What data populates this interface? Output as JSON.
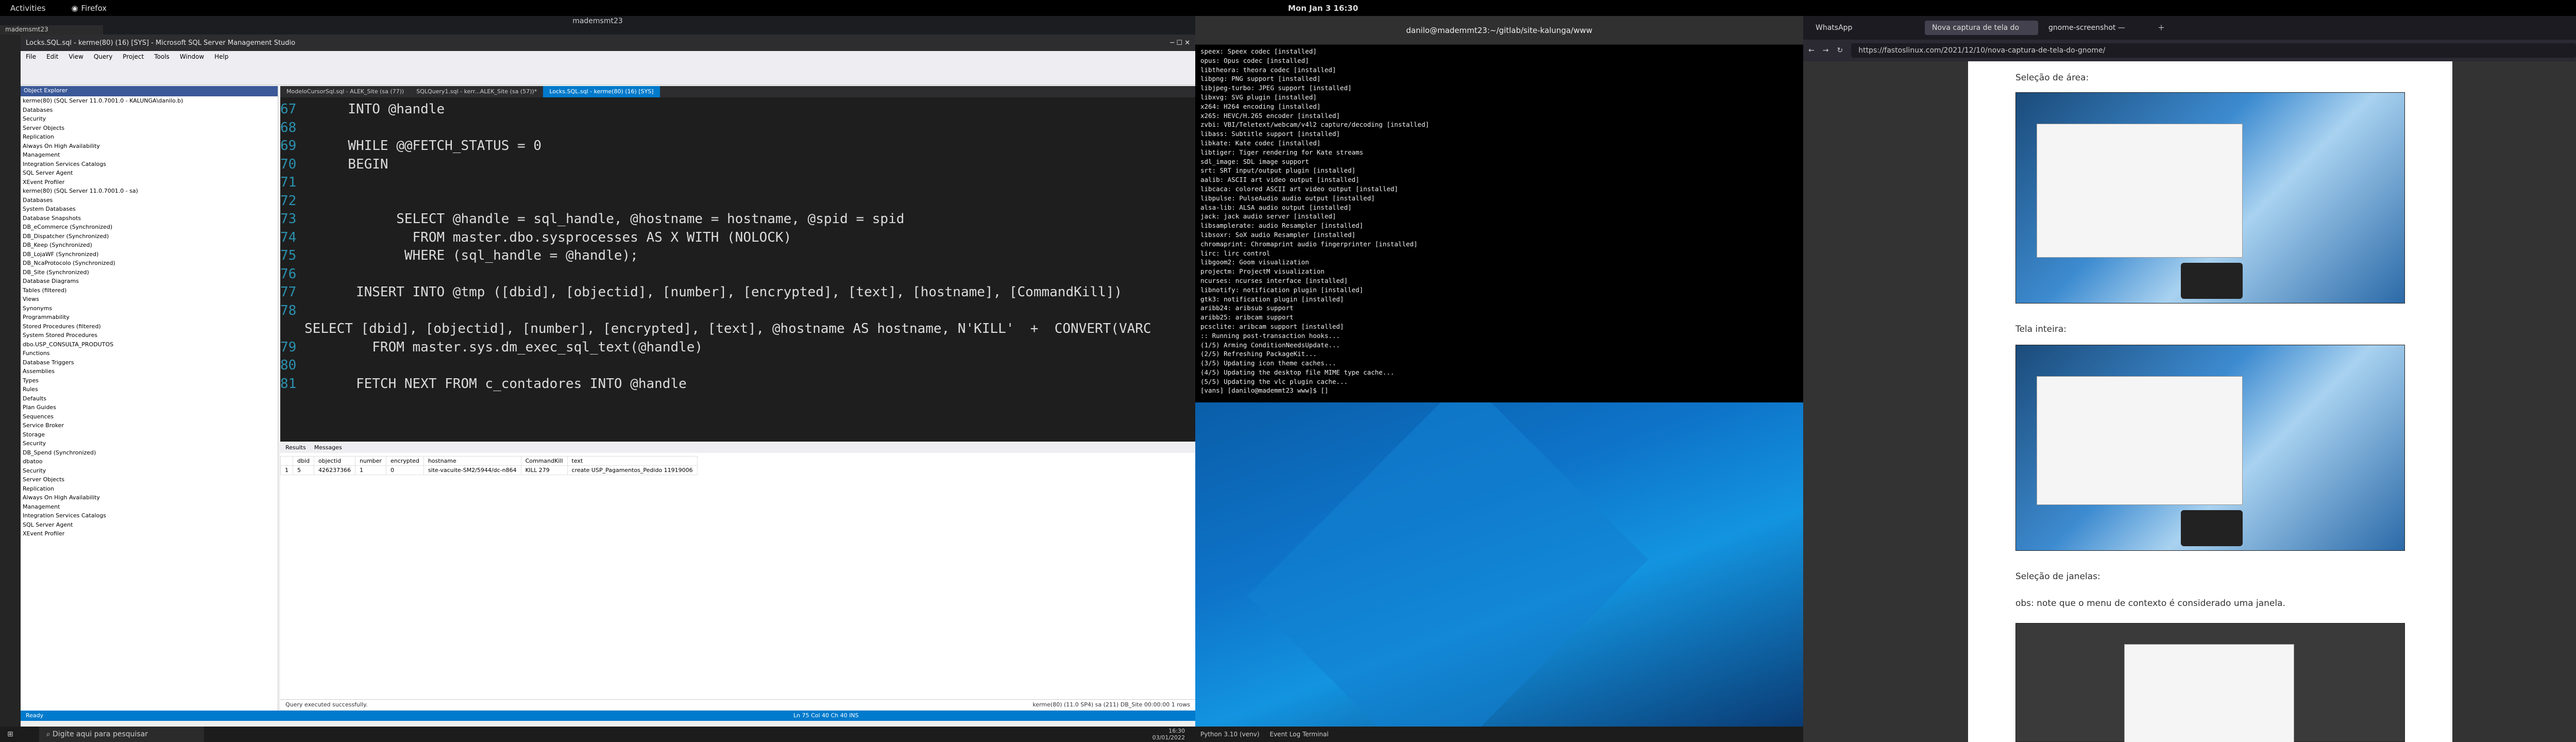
{
  "topbar": {
    "activities": "Activities",
    "app": "Firefox",
    "clock": "Mon Jan 3  16:30"
  },
  "vm": {
    "title": "mademsmt23",
    "tab": "mademsmt23"
  },
  "ssms": {
    "title": "Locks.SQL.sql - kerme(80) (16) [SYS] - Microsoft SQL Server Management Studio",
    "menu": [
      "File",
      "Edit",
      "View",
      "Query",
      "Project",
      "Tools",
      "Window",
      "Help"
    ],
    "objexp_title": "Object Explorer",
    "tree": [
      "kerme(80) (SQL Server 11.0.7001.0 - KALUNGA\\danilo.b)",
      "Databases",
      "Security",
      "Server Objects",
      "Replication",
      "Always On High Availability",
      "Management",
      "Integration Services Catalogs",
      "SQL Server Agent",
      "XEvent Profiler",
      "kerme(80) (SQL Server 11.0.7001.0 - sa)",
      "Databases",
      "System Databases",
      "Database Snapshots",
      "DB_eCommerce (Synchronized)",
      "DB_Dispatcher (Synchronized)",
      "DB_Keep (Synchronized)",
      "DB_LojaWF (Synchronized)",
      "DB_NcaProtocolo (Synchronized)",
      "DB_Site (Synchronized)",
      "Database Diagrams",
      "Tables (filtered)",
      "Views",
      "Synonyms",
      "Programmability",
      "Stored Procedures (filtered)",
      "System Stored Procedures",
      "dbo.USP_CONSULTA_PRODUTOS",
      "Functions",
      "Database Triggers",
      "Assemblies",
      "Types",
      "Rules",
      "Defaults",
      "Plan Guides",
      "Sequences",
      "Service Broker",
      "Storage",
      "Security",
      "DB_Spend (Synchronized)",
      "dbatoo",
      "Security",
      "Server Objects",
      "Replication",
      "Always On High Availability",
      "Management",
      "Integration Services Catalogs",
      "SQL Server Agent",
      "XEvent Profiler"
    ],
    "editor_tabs": [
      "ModeloCursorSql.sql - ALEK_Site (sa (77))",
      "SQLQuery1.sql - kerr...ALEK_Site (sa (57))*",
      "Locks.SQL.sql - kerme(80) (16) [SYS]"
    ],
    "code_lines": [
      {
        "n": "67",
        "t": "  INTO @handle"
      },
      {
        "n": "68",
        "t": ""
      },
      {
        "n": "69",
        "t": "  WHILE @@FETCH_STATUS = 0"
      },
      {
        "n": "70",
        "t": "  BEGIN"
      },
      {
        "n": "71",
        "t": ""
      },
      {
        "n": "72",
        "t": ""
      },
      {
        "n": "73",
        "t": "        SELECT @handle = sql_handle, @hostname = hostname, @spid = spid"
      },
      {
        "n": "74",
        "t": "          FROM master.dbo.sysprocesses AS X WITH (NOLOCK)"
      },
      {
        "n": "75",
        "t": "         WHERE (sql_handle = @handle);"
      },
      {
        "n": "76",
        "t": ""
      },
      {
        "n": "77",
        "t": "   INSERT INTO @tmp ([dbid], [objectid], [number], [encrypted], [text], [hostname], [CommandKill])"
      },
      {
        "n": "78",
        "t": "   SELECT [dbid], [objectid], [number], [encrypted], [text], @hostname AS hostname, N'KILL'  +  CONVERT(VARC"
      },
      {
        "n": "79",
        "t": "     FROM master.sys.dm_exec_sql_text(@handle)"
      },
      {
        "n": "80",
        "t": ""
      },
      {
        "n": "81",
        "t": "   FETCH NEXT FROM c_contadores INTO @handle"
      }
    ],
    "results_tabs": [
      "Results",
      "Messages"
    ],
    "grid_headers": [
      "",
      "dbid",
      "objectid",
      "number",
      "encrypted",
      "hostname",
      "CommandKill",
      "text"
    ],
    "grid_row": [
      "1",
      "5",
      "426237366",
      "1",
      "0",
      "site-vacuite-SM2/5944/dc-n864",
      "KILL 279",
      "create USP_Pagamentos_Pedido 11919006"
    ],
    "status_msg": "Query executed successfully.",
    "status_right": "kerme(80) (11.0 SP4)   sa (211)   DB_Site   00:00:00   1 rows",
    "statusbar": "Ready",
    "statusbar_pos": "Ln 75     Col 40     Ch 40     INS"
  },
  "taskbar": {
    "search": "Digite aqui para pesquisar",
    "time": "16:30",
    "date": "03/01/2022"
  },
  "terminal": {
    "title": "danilo@mademmt23:~/gitlab/site-kalunga/www",
    "lines": [
      "speex: Speex codec [installed]",
      "opus: Opus codec [installed]",
      "libtheora: theora codec [installed]",
      "libpng: PNG support [installed]",
      "libjpeg-turbo: JPEG support [installed]",
      "libxvg: SVG plugin [installed]",
      "x264: H264 encoding [installed]",
      "x265: HEVC/H.265 encoder [installed]",
      "zvbi: VBI/Teletext/webcam/v4l2 capture/decoding [installed]",
      "libass: Subtitle support [installed]",
      "libkate: Kate codec [installed]",
      "libtiger: Tiger rendering for Kate streams",
      "sdl_image: SDL image support",
      "srt: SRT input/output plugin [installed]",
      "aalib: ASCII art video output [installed]",
      "libcaca: colored ASCII art video output [installed]",
      "libpulse: PulseAudio audio output [installed]",
      "alsa-lib: ALSA audio output [installed]",
      "jack: jack audio server [installed]",
      "libsamplerate: audio Resampler [installed]",
      "libsoxr: SoX audio Resampler [installed]",
      "chromaprint: Chromaprint audio fingerprinter [installed]",
      "lirc: lirc control",
      "libgoom2: Goom visualization",
      "projectm: ProjectM visualization",
      "ncurses: ncurses interface [installed]",
      "libnotify: notification plugin [installed]",
      "gtk3: notification plugin [installed]",
      "aribb24: aribsub support",
      "aribb25: aribcam support",
      "pcsclite: aribcam support [installed]",
      ":: Running post-transaction hooks...",
      "(1/5) Arming ConditionNeedsUpdate...",
      "(2/5) Refreshing PackageKit...",
      "(3/5) Updating icon theme caches...",
      "(4/5) Updating the desktop file MIME type cache...",
      "(5/5) Updating the vlc plugin cache...",
      "[vans] [danilo@mademmt23 www]$ []"
    ]
  },
  "wallbar": {
    "left": "Python 3.10 (venv)",
    "right": "Event Log   Terminal"
  },
  "firefox": {
    "tabs": [
      "WhatsApp",
      "Nova captura de tela do",
      "gnome-screenshot —"
    ],
    "url": "https://fastoslinux.com/2021/12/10/nova-captura-de-tela-do-gnome/",
    "s1": "Seleção de área:",
    "s2": "Tela inteira:",
    "s3": "Seleção de janelas:",
    "note": "obs: note que o menu de contexto é considerado uma janela."
  }
}
